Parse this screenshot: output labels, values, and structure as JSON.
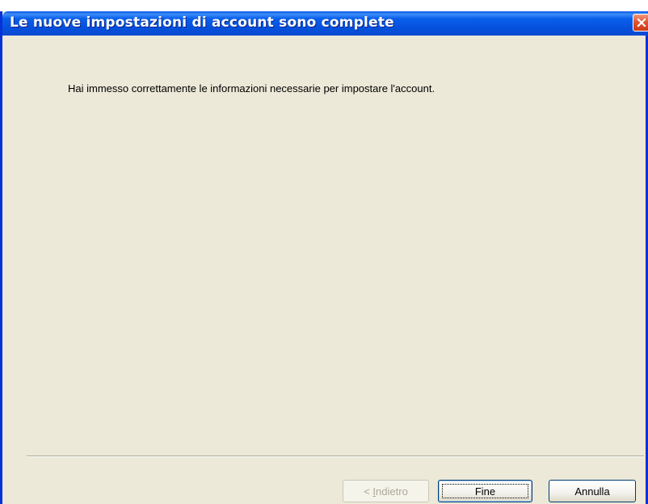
{
  "window": {
    "title": "Le nuove impostazioni di account sono complete",
    "close_icon": "close-icon"
  },
  "content": {
    "message": "Hai immesso correttamente le informazioni necessarie per impostare l'account."
  },
  "buttons": {
    "back_prefix": "< ",
    "back_mnemonic": "I",
    "back_rest": "ndietro",
    "back_enabled": false,
    "finish_label": "Fine",
    "cancel_label": "Annulla"
  },
  "colors": {
    "titlebar": "#0550dc",
    "window_face": "#ece9d8",
    "close_button": "#e2532f"
  }
}
